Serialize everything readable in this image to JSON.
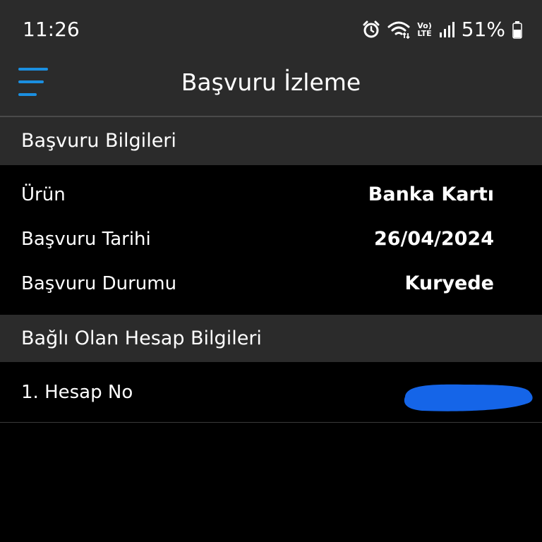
{
  "status_bar": {
    "time": "11:26",
    "lte_top": "Vo)",
    "lte_bottom": "LTE",
    "battery_percent": "51%"
  },
  "header": {
    "title": "Başvuru İzleme",
    "menu_icon": "hamburger-menu-icon"
  },
  "sections": {
    "application_info": {
      "title": "Başvuru Bilgileri",
      "rows": [
        {
          "label": "Ürün",
          "value": "Banka Kartı"
        },
        {
          "label": "Başvuru Tarihi",
          "value": "26/04/2024"
        },
        {
          "label": "Başvuru Durumu",
          "value": "Kuryede"
        }
      ]
    },
    "linked_accounts": {
      "title": "Bağlı Olan Hesap Bilgileri",
      "rows": [
        {
          "label": "1. Hesap No"
        }
      ]
    }
  },
  "colors": {
    "accent": "#1b8fe0",
    "header_bg": "#2b2b2b",
    "body_bg": "#000000",
    "redaction": "#1565e8"
  }
}
